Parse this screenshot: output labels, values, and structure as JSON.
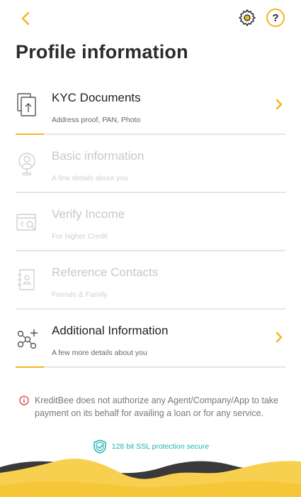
{
  "page": {
    "title": "Profile information"
  },
  "colors": {
    "accent": "#f5b81c",
    "disabled": "#c8c8c8",
    "ssl": "#1eb3b3",
    "wave_dark": "#3a3a3a",
    "wave_yellow": "#f8d04f"
  },
  "header": {
    "back_icon": "chevron-left-icon",
    "settings_icon": "gear-icon",
    "help_label": "?"
  },
  "items": [
    {
      "title": "KYC Documents",
      "subtitle": "Address proof, PAN, Photo",
      "icon": "documents-icon",
      "enabled": true
    },
    {
      "title": "Basic information",
      "subtitle": "A few details about you",
      "icon": "user-pin-icon",
      "enabled": false
    },
    {
      "title": "Verify Income",
      "subtitle": "For higher Credit",
      "icon": "income-search-icon",
      "enabled": false
    },
    {
      "title": "Reference Contacts",
      "subtitle": "Friends & Family",
      "icon": "contacts-book-icon",
      "enabled": false
    },
    {
      "title": "Additional Information",
      "subtitle": "A few more details about you",
      "icon": "nodes-add-icon",
      "enabled": true
    }
  ],
  "notice": {
    "text": "KreditBee does not authorize any Agent/Company/App to take payment on its behalf for availing a loan or for any service."
  },
  "ssl": {
    "label": "128 bit SSL protection secure"
  }
}
